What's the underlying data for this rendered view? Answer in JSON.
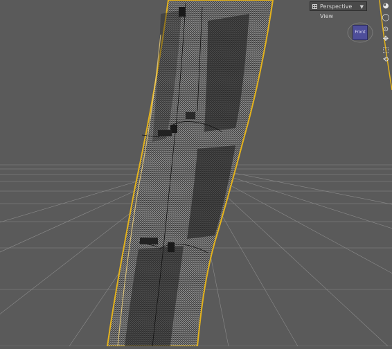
{
  "viewport": {
    "view_menu_label": "Perspective View",
    "cube_face_label": "Front",
    "background_color": "#5a5a5a",
    "grid_color": "#8c8c8c",
    "selection_color": "#e3b21c"
  },
  "toolbar": {
    "icons": [
      "sphere-icon",
      "zoom-icon",
      "orbit-icon",
      "pan-icon",
      "frame-icon",
      "camera-icon"
    ]
  }
}
